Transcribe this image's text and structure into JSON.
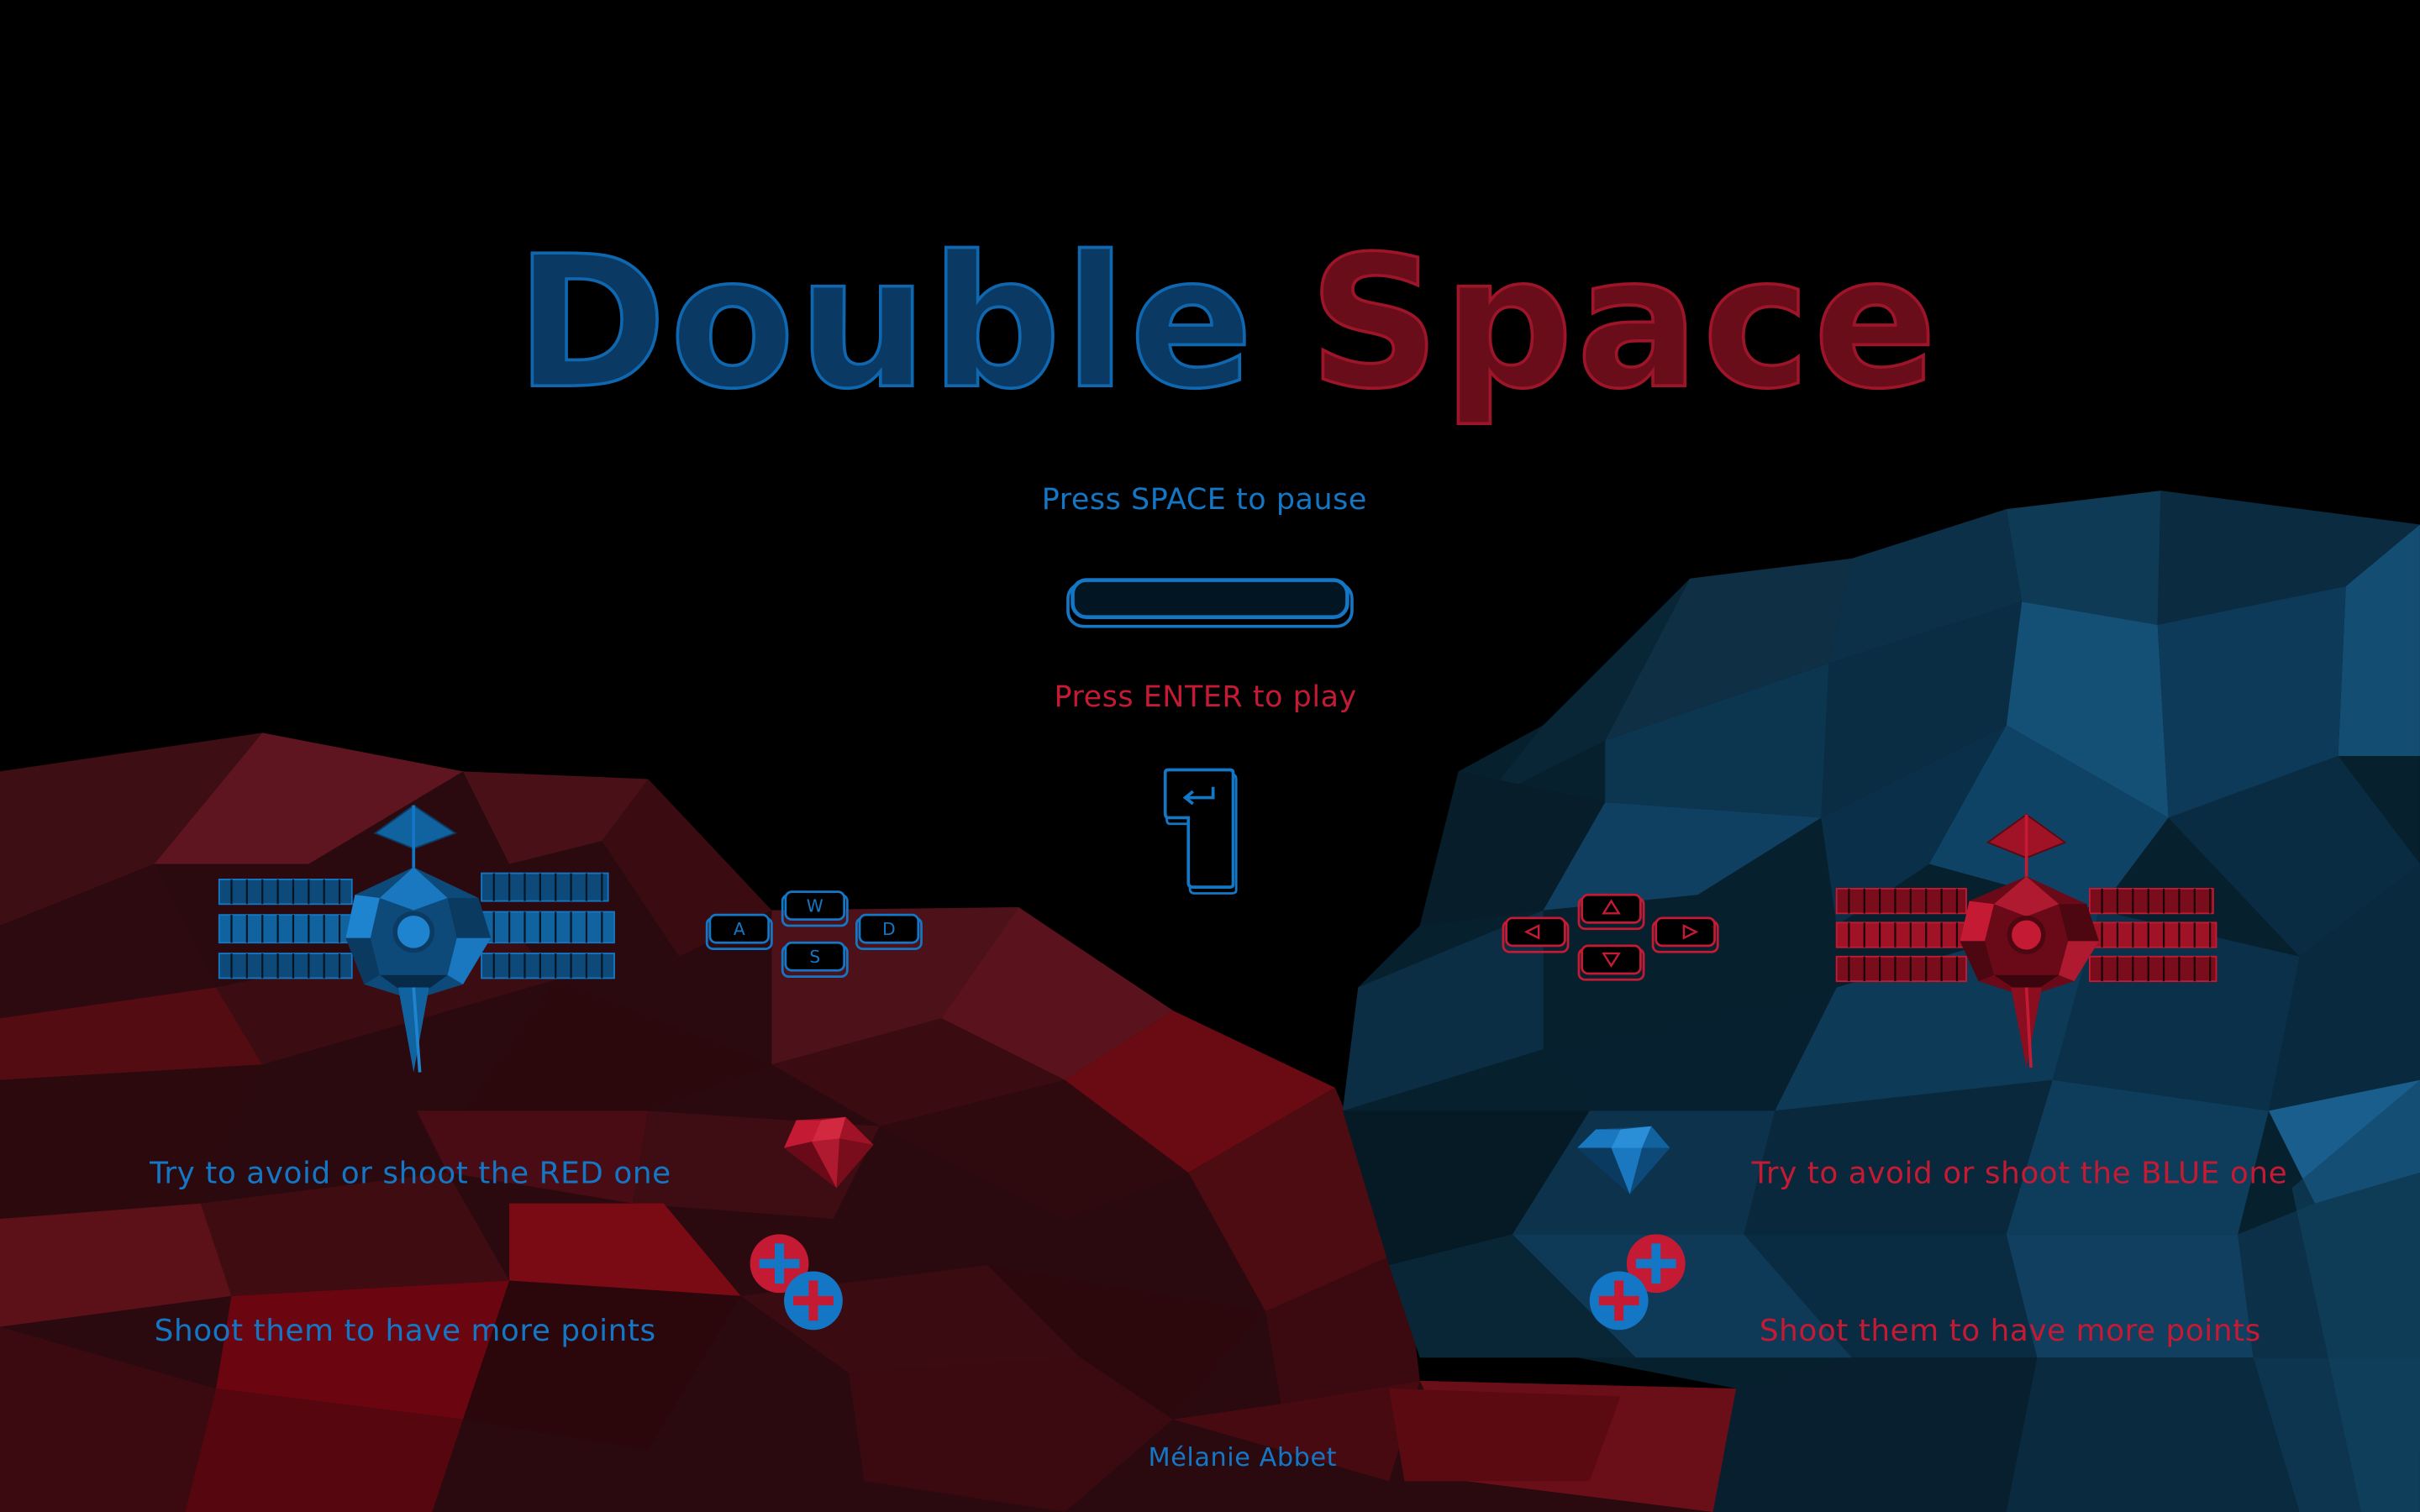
{
  "title": {
    "word1": "Double",
    "word2": "Space"
  },
  "instructions": {
    "pause": "Press SPACE to pause",
    "play": "Press ENTER to play"
  },
  "player1": {
    "keys": [
      "W",
      "A",
      "S",
      "D"
    ],
    "avoid_text": "Try to avoid or shoot the RED one",
    "bonus_text": "Shoot them to have more points"
  },
  "player2": {
    "keys": [
      "up-arrow",
      "left-arrow",
      "down-arrow",
      "right-arrow"
    ],
    "avoid_text": "Try to avoid or shoot the BLUE one",
    "bonus_text": "Shoot them to have more points"
  },
  "author": "Mélanie Abbet",
  "colors": {
    "blue": "#1377c6",
    "red": "#c41a34",
    "background": "#000000"
  }
}
